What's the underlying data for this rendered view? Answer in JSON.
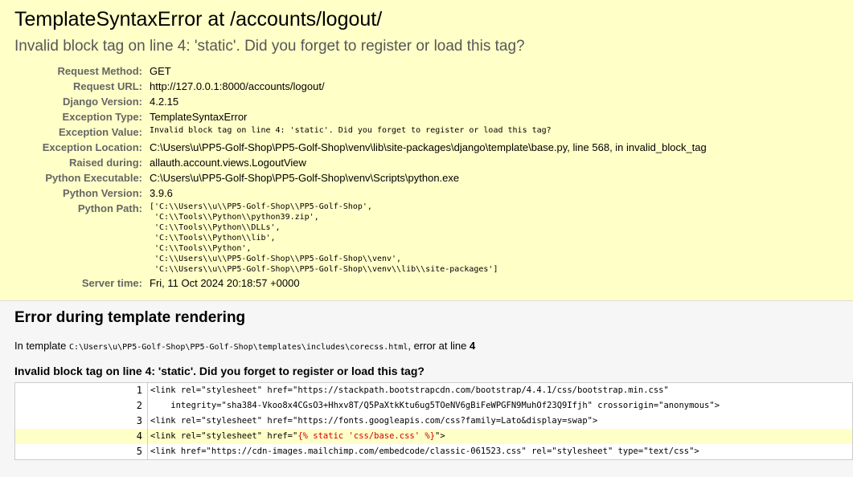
{
  "summary": {
    "title": "TemplateSyntaxError at /accounts/logout/",
    "subtitle": "Invalid block tag on line 4: 'static'. Did you forget to register or load this tag?",
    "rows": [
      {
        "label": "Request Method:",
        "value": "GET"
      },
      {
        "label": "Request URL:",
        "value": "http://127.0.0.1:8000/accounts/logout/"
      },
      {
        "label": "Django Version:",
        "value": "4.2.15"
      },
      {
        "label": "Exception Type:",
        "value": "TemplateSyntaxError"
      },
      {
        "label": "Exception Value:",
        "value": "Invalid block tag on line 4: 'static'. Did you forget to register or load this tag?"
      },
      {
        "label": "Exception Location:",
        "value": "C:\\Users\\u\\PP5-Golf-Shop\\PP5-Golf-Shop\\venv\\lib\\site-packages\\django\\template\\base.py, line 568, in invalid_block_tag"
      },
      {
        "label": "Raised during:",
        "value": "allauth.account.views.LogoutView"
      },
      {
        "label": "Python Executable:",
        "value": "C:\\Users\\u\\PP5-Golf-Shop\\PP5-Golf-Shop\\venv\\Scripts\\python.exe"
      },
      {
        "label": "Python Version:",
        "value": "3.9.6"
      },
      {
        "label": "Python Path:",
        "value": "['C:\\\\Users\\\\u\\\\PP5-Golf-Shop\\\\PP5-Golf-Shop',\n 'C:\\\\Tools\\\\Python\\\\python39.zip',\n 'C:\\\\Tools\\\\Python\\\\DLLs',\n 'C:\\\\Tools\\\\Python\\\\lib',\n 'C:\\\\Tools\\\\Python',\n 'C:\\\\Users\\\\u\\\\PP5-Golf-Shop\\\\PP5-Golf-Shop\\\\venv',\n 'C:\\\\Users\\\\u\\\\PP5-Golf-Shop\\\\PP5-Golf-Shop\\\\venv\\\\lib\\\\site-packages']"
      },
      {
        "label": "Server time:",
        "value": "Fri, 11 Oct 2024 20:18:57 +0000"
      }
    ]
  },
  "template": {
    "heading": "Error during template rendering",
    "in_prefix": "In template ",
    "path": "C:\\Users\\u\\PP5-Golf-Shop\\PP5-Golf-Shop\\templates\\includes\\corecss.html",
    "error_at": ", error at line ",
    "line": "4",
    "error_heading": "Invalid block tag on line 4: 'static'. Did you forget to register or load this tag?",
    "lines": [
      {
        "num": "1",
        "code": "<link rel=\"stylesheet\" href=\"https://stackpath.bootstrapcdn.com/bootstrap/4.4.1/css/bootstrap.min.css\""
      },
      {
        "num": "2",
        "code": "    integrity=\"sha384-Vkoo8x4CGsO3+Hhxv8T/Q5PaXtkKtu6ug5TOeNV6gBiFeWPGFN9MuhOf23Q9Ifjh\" crossorigin=\"anonymous\">"
      },
      {
        "num": "3",
        "code": "<link rel=\"stylesheet\" href=\"https://fonts.googleapis.com/css?family=Lato&display=swap\">"
      },
      {
        "num": "4",
        "pre": "<link rel=\"stylesheet\" href=\"",
        "err": "{% static 'css/base.css' %}",
        "post": "\">"
      },
      {
        "num": "5",
        "code": "<link href=\"https://cdn-images.mailchimp.com/embedcode/classic-061523.css\" rel=\"stylesheet\" type=\"text/css\">"
      }
    ]
  }
}
